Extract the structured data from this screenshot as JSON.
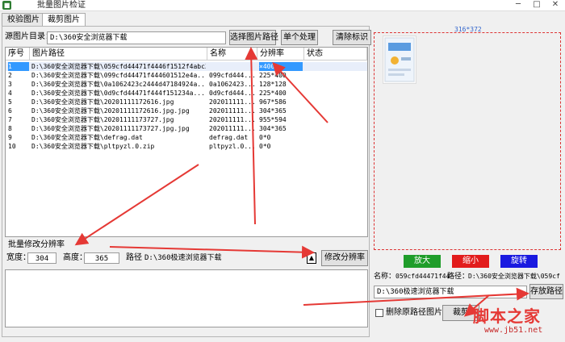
{
  "window": {
    "title": "批量图片检证",
    "min": "─",
    "max": "□",
    "close": "✕"
  },
  "tabs": [
    {
      "label": "校验图片"
    },
    {
      "label": "裁剪图片"
    }
  ],
  "source": {
    "label": "源图片目录：",
    "value": "D:\\360安全浏览器下载",
    "select_button": "选择图片路径",
    "single_button": "单个处理",
    "clear_button": "清除标识"
  },
  "table": {
    "headers": [
      "序号",
      "图片路径",
      "名称",
      "分辨率",
      "状态"
    ],
    "rows": [
      {
        "num": "1",
        "path": "D:\\360安全浏览器下载\\059cfd44471f4446f1512f4abc3a39fa6ee5bd0…2.jpg",
        "name": "",
        "res": "×400",
        "status": ""
      },
      {
        "num": "2",
        "path": "D:\\360安全浏览器下载\\099cfd44471f444601512e4a...",
        "name": "099cfd444...",
        "res": "225*400",
        "status": ""
      },
      {
        "num": "3",
        "path": "D:\\360安全浏览器下载\\0a1062423c2444d47184924a...",
        "name": "0a1062423...",
        "res": "128*128",
        "status": ""
      },
      {
        "num": "4",
        "path": "D:\\360安全浏览器下载\\0d9cfd44471f444f151234a...",
        "name": "0d9cfd444...",
        "res": "225*400",
        "status": ""
      },
      {
        "num": "5",
        "path": "D:\\360安全浏览器下载\\20201111172616.jpg",
        "name": "202011111...",
        "res": "967*586",
        "status": ""
      },
      {
        "num": "6",
        "path": "D:\\360安全浏览器下载\\20201111172616.jpg.jpg",
        "name": "202011111...",
        "res": "304*365",
        "status": ""
      },
      {
        "num": "7",
        "path": "D:\\360安全浏览器下载\\20201111173727.jpg",
        "name": "202011111...",
        "res": "955*594",
        "status": ""
      },
      {
        "num": "8",
        "path": "D:\\360安全浏览器下载\\20201111173727.jpg.jpg",
        "name": "202011111...",
        "res": "304*365",
        "status": ""
      },
      {
        "num": "9",
        "path": "D:\\360安全浏览器下载\\defrag.dat",
        "name": "defrag.dat",
        "res": "0*0",
        "status": ""
      },
      {
        "num": "10",
        "path": "D:\\360安全浏览器下载\\pltpyzl.0.zip",
        "name": "pltpyzl.0...",
        "res": "0*0",
        "status": ""
      }
    ]
  },
  "batch": {
    "title": "批量修改分辨率",
    "width_label": "宽度：",
    "width_value": "304",
    "height_label": "高度：",
    "height_value": "365",
    "path_label": "路径",
    "path_value": "D:\\360极速浏览器下载",
    "modify_button": "修改分辨率"
  },
  "preview": {
    "dimension": "316*372",
    "zoom_in": "放大",
    "zoom_out": "缩小",
    "rotate": "旋转",
    "name_label": "名称：",
    "name_value": "059cfd44471f44",
    "path_label": "路径：",
    "path_value": "D:\\360安全浏览器下载\\059cf",
    "save_path_value": "D:\\360极速浏览器下载",
    "save_path_button": "存放路径",
    "delete_label": "删除原路径图片",
    "crop_button": "裁剪"
  },
  "watermark": {
    "line1": "脚本之家",
    "line2": "www.jb51.net"
  },
  "colors": {
    "green": "#1f9d2a",
    "red": "#e21b1b",
    "blue": "#1a1ae0",
    "arrow": "#e53935"
  }
}
